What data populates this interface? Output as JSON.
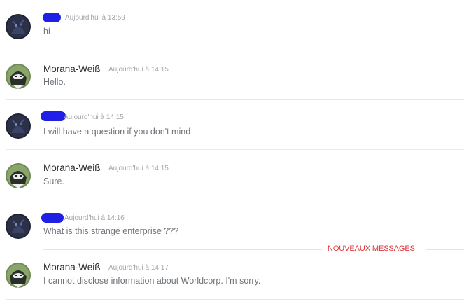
{
  "messages": [
    {
      "author": "",
      "author_redacted": true,
      "avatar": "dark-armored-avatar",
      "timestamp": "Aujourd'hui à 13:59",
      "text": "hi"
    },
    {
      "author": "Morana-Weiß",
      "author_redacted": false,
      "avatar": "green-hooded-avatar",
      "timestamp": "Aujourd'hui à 14:15",
      "text": "Hello."
    },
    {
      "author": "",
      "author_redacted": true,
      "avatar": "dark-armored-avatar",
      "timestamp": "Aujourd'hui à 14:15",
      "text": "I will have a question if you don't mind"
    },
    {
      "author": "Morana-Weiß",
      "author_redacted": false,
      "avatar": "green-hooded-avatar",
      "timestamp": "Aujourd'hui à 14:15",
      "text": "Sure."
    },
    {
      "author": "",
      "author_redacted": true,
      "avatar": "dark-armored-avatar",
      "timestamp": "Aujourd'hui à 14:16",
      "text": "What is this strange enterprise ???"
    },
    {
      "author": "Morana-Weiß",
      "author_redacted": false,
      "avatar": "green-hooded-avatar",
      "timestamp": "Aujourd'hui à 14:17",
      "text": "I cannot disclose information about Worldcorp. I'm sorry."
    }
  ],
  "new_messages_label": "NOUVEAUX MESSAGES",
  "colors": {
    "new_messages_red": "#e0353b",
    "redaction_blue": "#1f1fe6",
    "timestamp_gray": "#a2a6ab",
    "text_gray": "#6f747a"
  }
}
